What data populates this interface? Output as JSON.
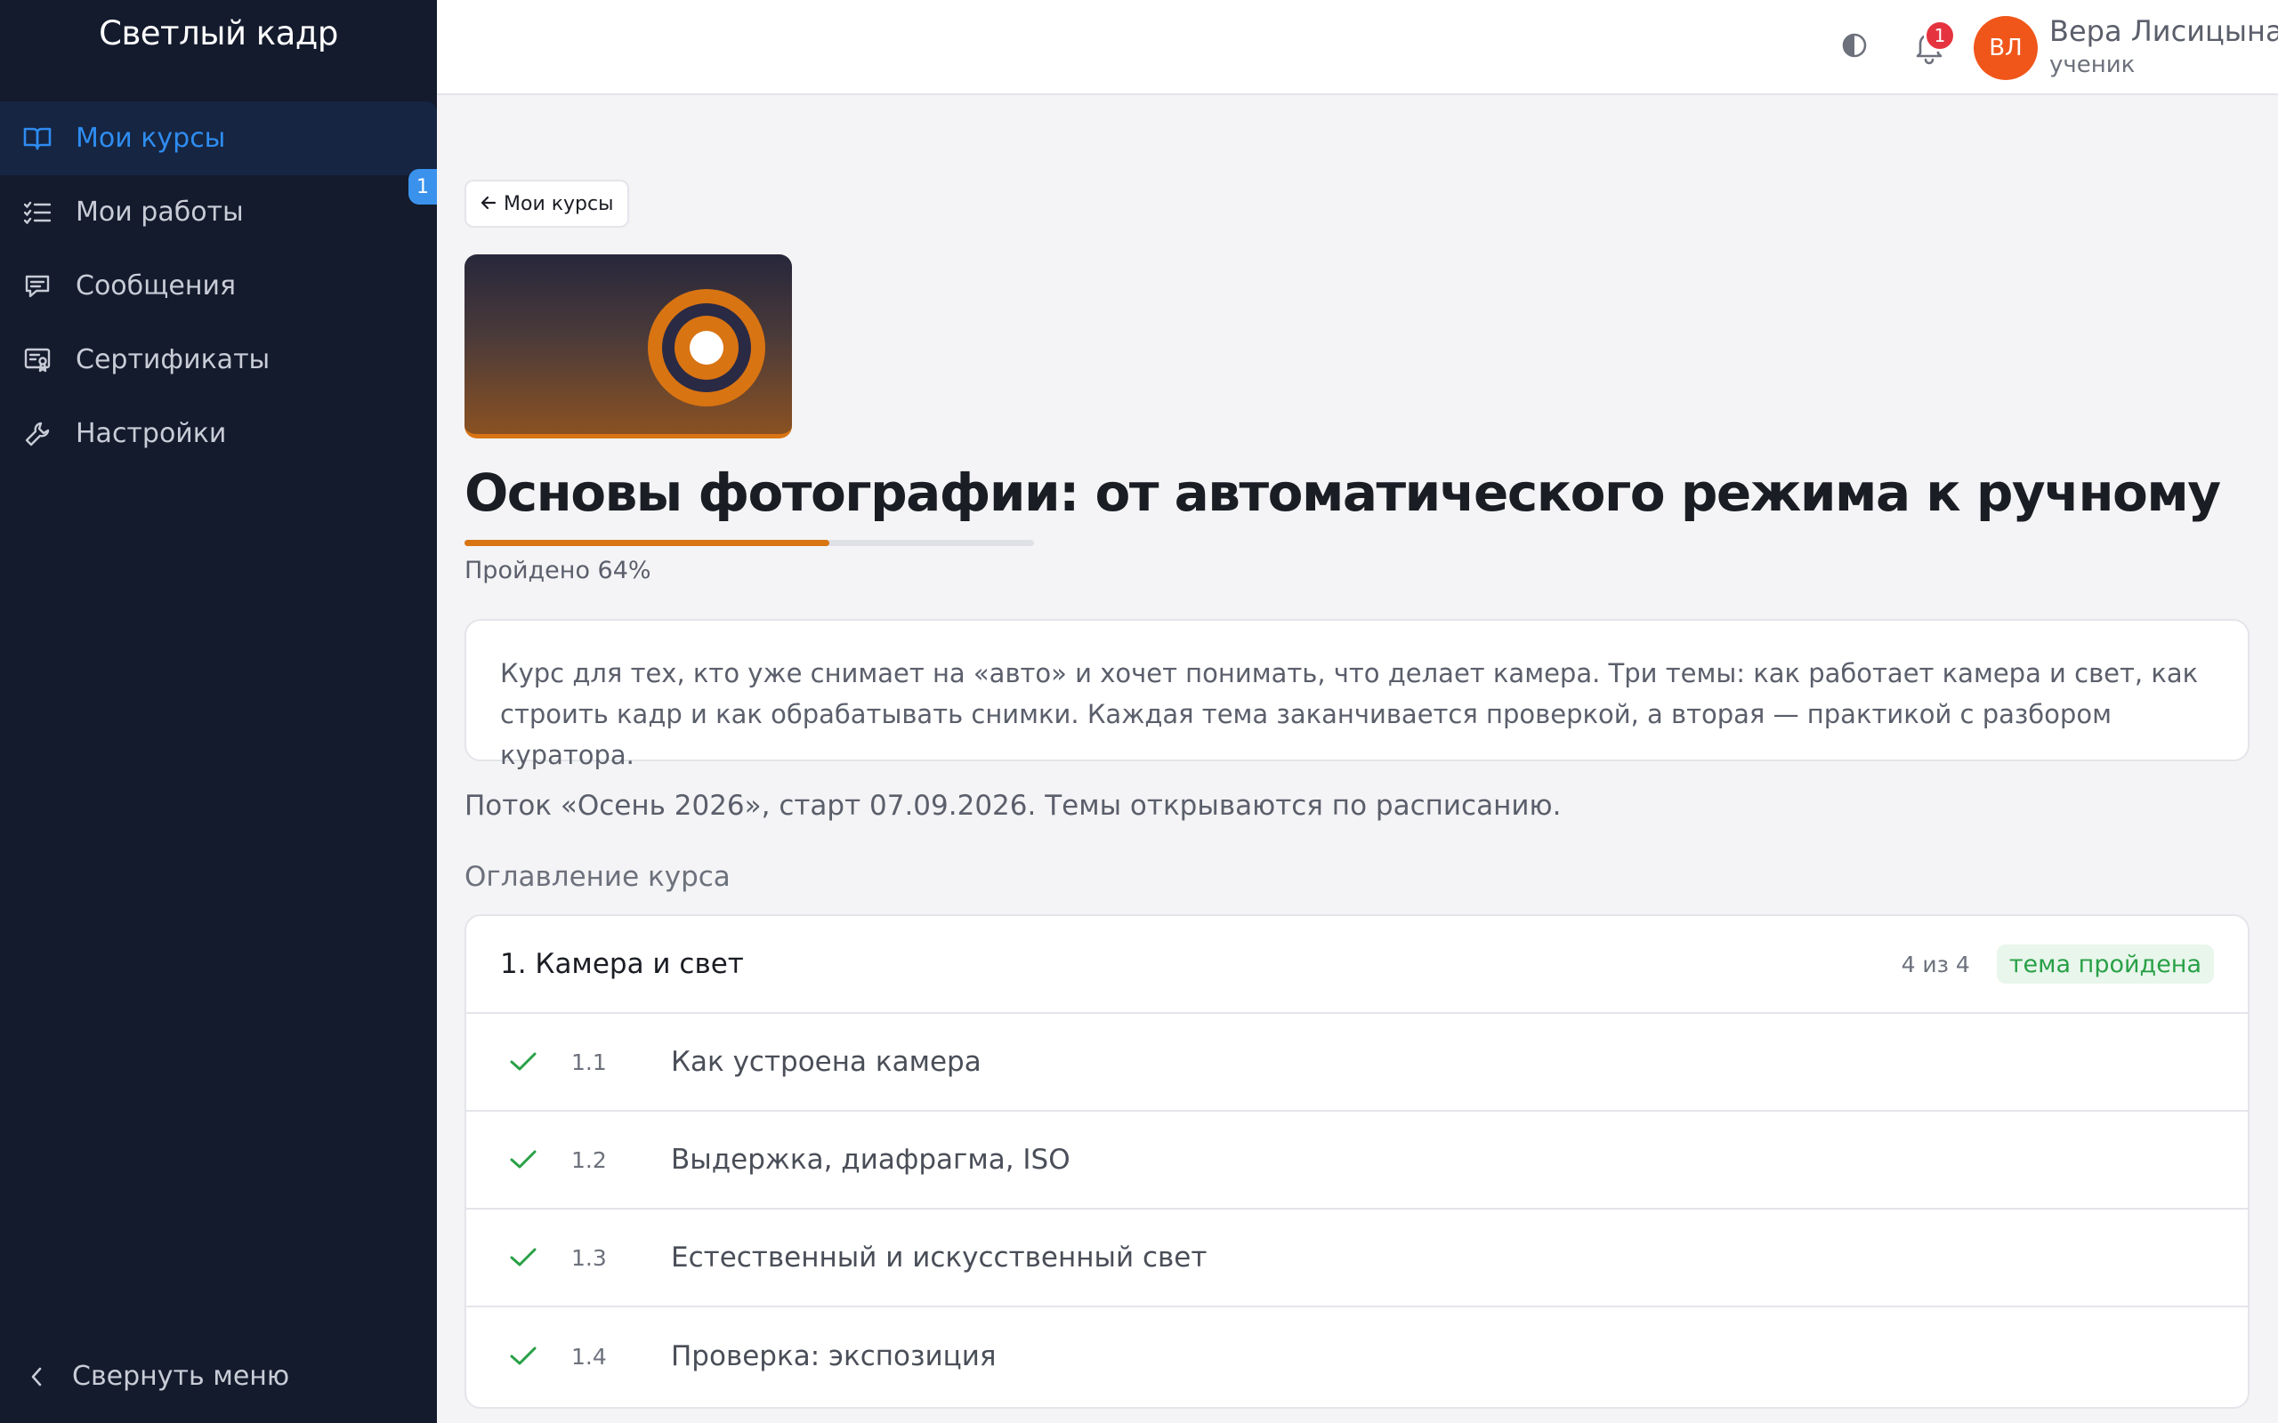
{
  "app": {
    "brand": "Светлый кадр"
  },
  "sidebar": {
    "items": [
      {
        "label": "Мои курсы",
        "icon": "book-open-icon",
        "active": true
      },
      {
        "label": "Мои работы",
        "icon": "checklist-icon",
        "badge": "1"
      },
      {
        "label": "Сообщения",
        "icon": "message-icon"
      },
      {
        "label": "Сертификаты",
        "icon": "certificate-icon"
      },
      {
        "label": "Настройки",
        "icon": "wrench-icon"
      }
    ],
    "collapse_label": "Свернуть меню"
  },
  "header": {
    "notifications_count": "1",
    "user": {
      "initials": "ВЛ",
      "name": "Вера Лисицына",
      "role": "ученик"
    }
  },
  "course": {
    "back_label": "Мои курсы",
    "title": "Основы фотографии: от автоматического режима к ручному",
    "progress_percent": 64,
    "progress_label": "Пройдено 64%",
    "description": "Курс для тех, кто уже снимает на «авто» и хочет понимать, что делает камера. Три темы: как работает камера и свет, как строить кадр и как обрабатывать снимки. Каждая тема заканчивается проверкой, а вторая — практикой с разбором куратора.",
    "stream_info": "Поток «Осень 2026», старт 07.09.2026. Темы открываются по расписанию.",
    "toc_label": "Оглавление курса",
    "topics": [
      {
        "title": "1. Камера и свет",
        "count": "4 из 4",
        "status": "тема пройдена",
        "lessons": [
          {
            "num": "1.1",
            "title": "Как устроена камера",
            "done": true
          },
          {
            "num": "1.2",
            "title": "Выдержка, диафрагма, ISO",
            "done": true
          },
          {
            "num": "1.3",
            "title": "Естественный и искусственный свет",
            "done": true
          },
          {
            "num": "1.4",
            "title": "Проверка: экспозиция",
            "done": true
          }
        ]
      }
    ]
  },
  "colors": {
    "sidebar_bg": "#141b2d",
    "accent": "#2f8cf0",
    "progress": "#d97412",
    "success": "#29a046",
    "avatar": "#f0561a"
  }
}
